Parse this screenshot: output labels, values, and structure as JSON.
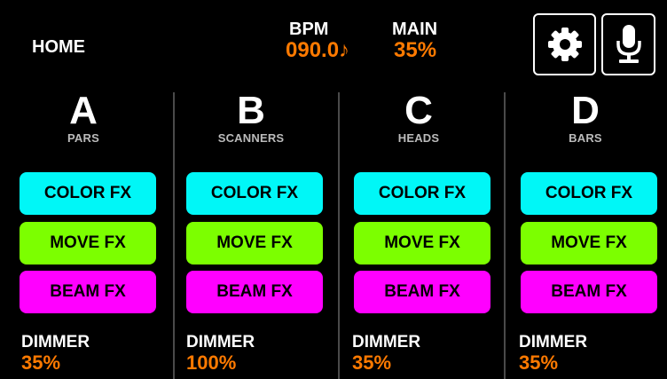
{
  "header": {
    "home_label": "HOME",
    "bpm": {
      "label": "BPM",
      "value": "090.0♪"
    },
    "main": {
      "label": "MAIN",
      "value": "35%"
    },
    "settings_icon": "gear-icon",
    "mic_icon": "microphone-icon"
  },
  "colors": {
    "background": "#000000",
    "value_orange": "#ff7a00",
    "color_fx": "#00f7f7",
    "move_fx": "#7cff00",
    "beam_fx": "#ff00ff",
    "divider": "#4a4a4a"
  },
  "groups": [
    {
      "letter": "A",
      "name": "PARS",
      "buttons": {
        "color": "COLOR FX",
        "move": "MOVE FX",
        "beam": "BEAM FX"
      },
      "dimmer": {
        "label": "DIMMER",
        "value": "35%"
      }
    },
    {
      "letter": "B",
      "name": "SCANNERS",
      "buttons": {
        "color": "COLOR FX",
        "move": "MOVE FX",
        "beam": "BEAM FX"
      },
      "dimmer": {
        "label": "DIMMER",
        "value": "100%"
      }
    },
    {
      "letter": "C",
      "name": "HEADS",
      "buttons": {
        "color": "COLOR FX",
        "move": "MOVE FX",
        "beam": "BEAM FX"
      },
      "dimmer": {
        "label": "DIMMER",
        "value": "35%"
      }
    },
    {
      "letter": "D",
      "name": "BARS",
      "buttons": {
        "color": "COLOR FX",
        "move": "MOVE FX",
        "beam": "BEAM FX"
      },
      "dimmer": {
        "label": "DIMMER",
        "value": "35%"
      }
    }
  ]
}
